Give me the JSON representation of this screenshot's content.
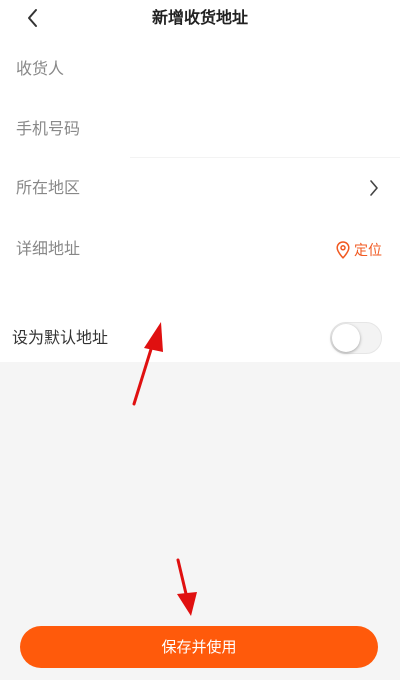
{
  "header": {
    "title": "新增收货地址",
    "back_icon": "chevron-left-icon"
  },
  "form": {
    "receiver_placeholder": "收货人",
    "phone_placeholder": "手机号码",
    "region_label": "所在地区",
    "address_placeholder": "详细地址",
    "locate_label": "定位",
    "default_label": "设为默认地址",
    "default_enabled": false
  },
  "actions": {
    "save_label": "保存并使用"
  },
  "colors": {
    "accent": "#ff5a0b",
    "locate": "#f15a22",
    "placeholder": "#888888",
    "annotation_arrow": "#e01010"
  }
}
